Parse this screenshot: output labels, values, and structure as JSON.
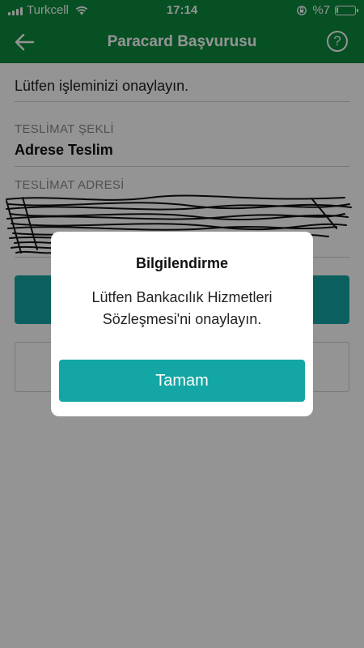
{
  "status_bar": {
    "carrier": "Turkcell",
    "time": "17:14",
    "battery": "%7"
  },
  "nav": {
    "title": "Paracard Başvurusu",
    "help_symbol": "?"
  },
  "form": {
    "instruction": "Lütfen işleminizi onaylayın.",
    "delivery_method_label": "TESLİMAT ŞEKLİ",
    "delivery_method_value": "Adrese Teslim",
    "delivery_address_label": "TESLİMAT ADRESİ"
  },
  "dialog": {
    "title": "Bilgilendirme",
    "message_line1": "Lütfen Bankacılık Hizmetleri",
    "message_line2": "Sözleşmesi'ni onaylayın.",
    "button_label": "Tamam"
  },
  "colors": {
    "brand_green": "#0c8a3e",
    "accent_teal": "#14a6a4"
  }
}
